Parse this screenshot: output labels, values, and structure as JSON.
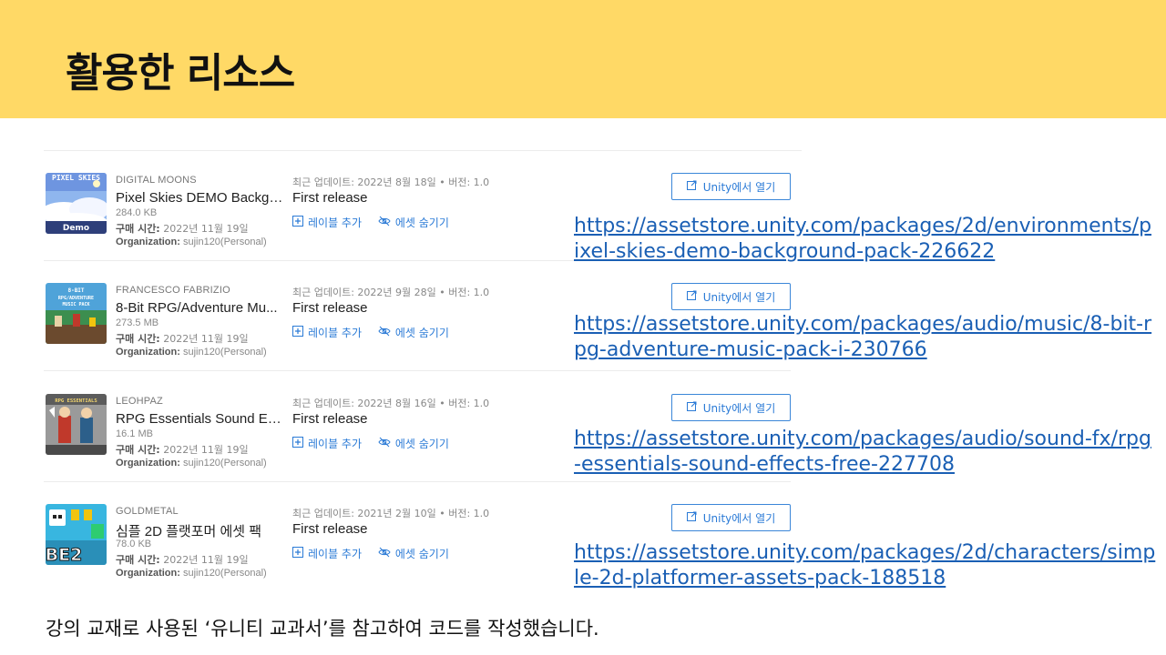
{
  "slide": {
    "title": "활용한 리소스",
    "footer": "강의 교재로 사용된 ‘유니티 교과서’를 참고하여 코드를 작성했습니다."
  },
  "labels": {
    "add_label": "레이블 추가",
    "hide_asset": "에셋 숨기기",
    "open_in_unity": "Unity에서 열기",
    "purchase_prefix": "구매 시간:",
    "org_prefix": "Organization:"
  },
  "assets": [
    {
      "thumb_text": "PIXEL SKIES",
      "thumb_sub": "Demo",
      "publisher": "DIGITAL MOONS",
      "name": "Pixel Skies DEMO Backgr...",
      "size": "284.0 KB",
      "purchase_time": "2022년 11월 19일",
      "organization": "sujin120(Personal)",
      "updated": "최근 업데이트: 2022년 8월 18일 • 버전: 1.0",
      "release": "First release",
      "link": "https://assetstore.unity.com/packages/2d/environments/pixel-skies-demo-background-pack-226622"
    },
    {
      "thumb_text": "8-BIT RPG/ADVENTURE MUSIC PACK",
      "thumb_sub": "",
      "publisher": "FRANCESCO FABRIZIO",
      "name": "8-Bit RPG/Adventure Mu...",
      "size": "273.5 MB",
      "purchase_time": "2022년 11월 19일",
      "organization": "sujin120(Personal)",
      "updated": "최근 업데이트: 2022년 9월 28일 • 버전: 1.0",
      "release": "First release",
      "link": "https://assetstore.unity.com/packages/audio/music/8-bit-rpg-adventure-music-pack-i-230766"
    },
    {
      "thumb_text": "RPG ESSENTIALS",
      "thumb_sub": "",
      "publisher": "LEOHPAZ",
      "name": "RPG Essentials Sound Eff...",
      "size": "16.1 MB",
      "purchase_time": "2022년 11월 19일",
      "organization": "sujin120(Personal)",
      "updated": "최근 업데이트: 2022년 8월 16일 • 버전: 1.0",
      "release": "First release",
      "link": "https://assetstore.unity.com/packages/audio/sound-fx/rpg-essentials-sound-effects-free-227708"
    },
    {
      "thumb_text": "BE2",
      "thumb_sub": "",
      "publisher": "GOLDMETAL",
      "name": "심플 2D 플랫포머 에셋 팩",
      "size": "78.0 KB",
      "purchase_time": "2022년 11월 19일",
      "organization": "sujin120(Personal)",
      "updated": "최근 업데이트: 2021년 2월 10일 • 버전: 1.0",
      "release": "First release",
      "link": "https://assetstore.unity.com/packages/2d/characters/simple-2d-platformer-assets-pack-188518"
    }
  ],
  "colors": {
    "header_bg": "#ffd966",
    "link": "#1a5fb4",
    "action_blue": "#2a7ad6"
  }
}
